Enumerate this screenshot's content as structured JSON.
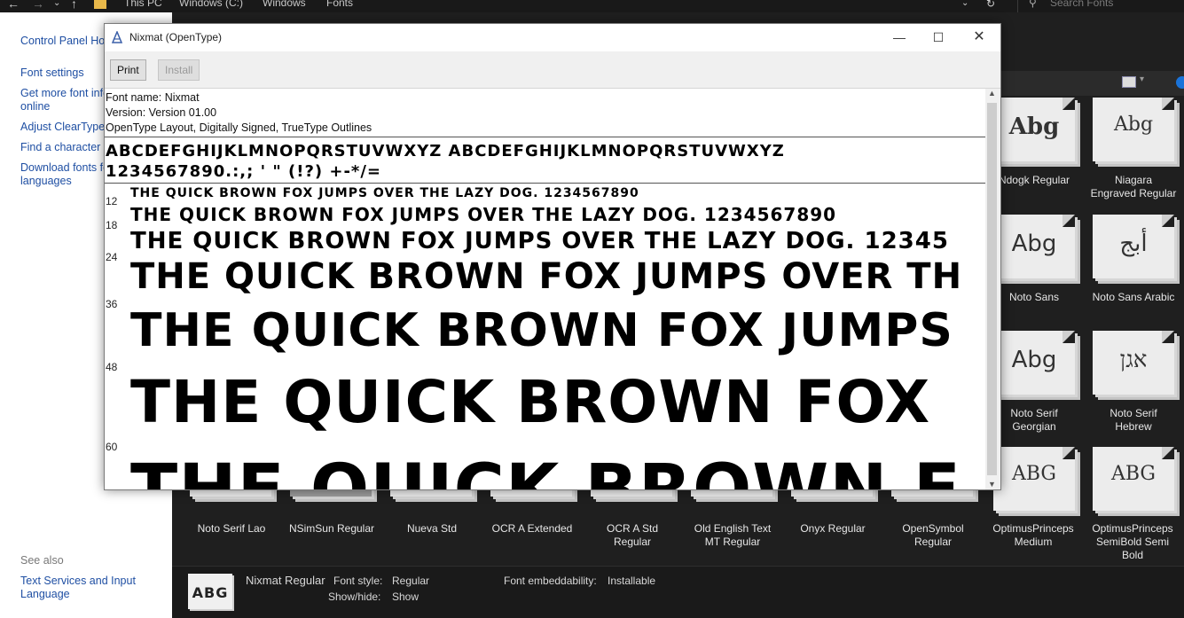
{
  "explorer": {
    "breadcrumb": [
      "This PC",
      "Windows (C:)",
      "Windows",
      "Fonts"
    ],
    "search_placeholder": "Search Fonts",
    "left_links": [
      "Control Panel Hom",
      "Font settings",
      "Get more font info",
      "online",
      "Adjust ClearType t",
      "Find a character",
      "Download fonts fo",
      "languages"
    ],
    "see_also_label": "See also",
    "see_also_links": [
      "Text Services and Input",
      "Language"
    ]
  },
  "tiles_right": [
    {
      "sample": "Abg",
      "name1": "Ndogk Regular",
      "name2": ""
    },
    {
      "sample": "Abg",
      "name1": "Niagara",
      "name2": "Engraved Regular"
    },
    {
      "sample": "Abg",
      "name1": "Noto Sans",
      "name2": ""
    },
    {
      "sample": "أبج",
      "name1": "Noto Sans Arabic",
      "name2": ""
    },
    {
      "sample": "Abg",
      "name1": "Noto Serif",
      "name2": "Georgian"
    },
    {
      "sample": "אגן",
      "name1": "Noto Serif",
      "name2": "Hebrew"
    },
    {
      "sample": "ABG",
      "name1": "",
      "name2": ""
    },
    {
      "sample": "ABG",
      "name1": "",
      "name2": ""
    }
  ],
  "tiles_bottom": [
    {
      "name1": "Noto Serif Lao",
      "name2": ""
    },
    {
      "name1": "NSimSun Regular",
      "name2": ""
    },
    {
      "name1": "Nueva Std",
      "name2": ""
    },
    {
      "name1": "OCR A Extended",
      "name2": ""
    },
    {
      "name1": "OCR A Std",
      "name2": "Regular"
    },
    {
      "name1": "Old English Text",
      "name2": "MT Regular"
    },
    {
      "name1": "Onyx Regular",
      "name2": ""
    },
    {
      "name1": "OpenSymbol",
      "name2": "Regular"
    },
    {
      "name1": "OptimusPrinceps",
      "name2": "Medium"
    },
    {
      "name1": "OptimusPrinceps",
      "name2": "SemiBold Semi",
      "name3": "Bold"
    }
  ],
  "details": {
    "thumb": "ABG",
    "name": "Nixmat Regular",
    "style_label": "Font style:",
    "style_value": "Regular",
    "showhide_label": "Show/hide:",
    "showhide_value": "Show",
    "embed_label": "Font embeddability:",
    "embed_value": "Installable"
  },
  "viewer": {
    "title": "Nixmat (OpenType)",
    "print_label": "Print",
    "install_label": "Install",
    "minimize": "—",
    "maximize": "☐",
    "close": "✕",
    "font_name": "Font name: Nixmat",
    "version": "Version: Version 01.00",
    "features": "OpenType Layout, Digitally Signed, TrueType Outlines",
    "alphabet": "ABCDEFGHIJKLMNOPQRSTUVWXYZ ABCDEFGHIJKLMNOPQRSTUVWXYZ",
    "digits": "1234567890.:,; ' \" (!?) +-*/=",
    "samples": [
      {
        "size": "12",
        "text": "THE QUICK BROWN FOX JUMPS OVER THE LAZY DOG. 1234567890"
      },
      {
        "size": "18",
        "text": "THE QUICK BROWN FOX JUMPS OVER THE LAZY DOG. 1234567890"
      },
      {
        "size": "24",
        "text": "THE QUICK BROWN FOX JUMPS OVER THE LAZY DOG. 12345"
      },
      {
        "size": "36",
        "text": "THE QUICK BROWN FOX JUMPS OVER TH"
      },
      {
        "size": "48",
        "text": "THE QUICK BROWN FOX JUMPS"
      },
      {
        "size": "60",
        "text": "THE QUICK BROWN FOX"
      },
      {
        "size": "",
        "text": "THE QUICK BROWN F"
      }
    ]
  }
}
